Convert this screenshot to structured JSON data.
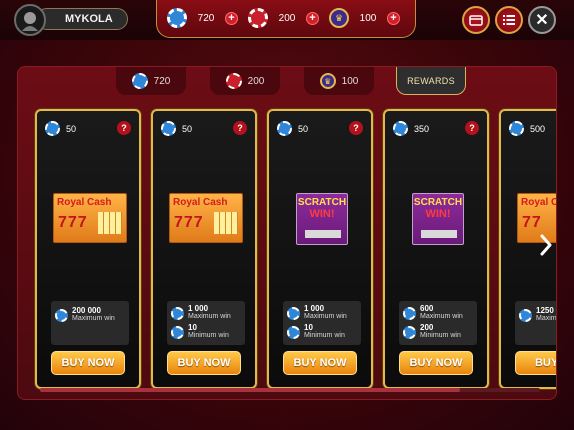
{
  "header": {
    "username": "MYKOLA",
    "currencies": [
      {
        "name": "blue-chips",
        "value": "720"
      },
      {
        "name": "red-chips",
        "value": "200"
      },
      {
        "name": "gold-tickets",
        "value": "100"
      }
    ],
    "plus_label": "+",
    "close_label": "✕"
  },
  "tabs": [
    {
      "value": "720"
    },
    {
      "value": "200"
    },
    {
      "value": "100"
    },
    {
      "label": "REWARDS"
    }
  ],
  "cards": [
    {
      "cost": "50",
      "ticket": "Royal Cash",
      "ticket_num": "777",
      "max_value": "200 000",
      "max_label": "Maximum win",
      "min_value": "",
      "min_label": "",
      "button": "BUY NOW"
    },
    {
      "cost": "50",
      "ticket": "Royal Cash",
      "ticket_num": "777",
      "max_value": "1 000",
      "max_label": "Maximum win",
      "min_value": "10",
      "min_label": "Minimum win",
      "button": "BUY NOW"
    },
    {
      "cost": "50",
      "ticket": "SCRATCH",
      "ticket_num": "WIN!",
      "max_value": "1 000",
      "max_label": "Maximum win",
      "min_value": "10",
      "min_label": "Minimum win",
      "button": "BUY NOW"
    },
    {
      "cost": "350",
      "ticket": "SCRATCH",
      "ticket_num": "WIN!",
      "max_value": "600",
      "max_label": "Maximum win",
      "min_value": "200",
      "min_label": "Minimum win",
      "button": "BUY NOW"
    },
    {
      "cost": "500",
      "ticket": "Royal Ca",
      "ticket_num": "77",
      "max_value": "1250",
      "max_label": "Maxim",
      "min_value": "",
      "min_label": "",
      "button": "BUY N"
    }
  ],
  "help_label": "?",
  "colors": {
    "gold": "#e6b84a",
    "accent_red": "#b3121d",
    "button_orange": "#e8850e"
  }
}
